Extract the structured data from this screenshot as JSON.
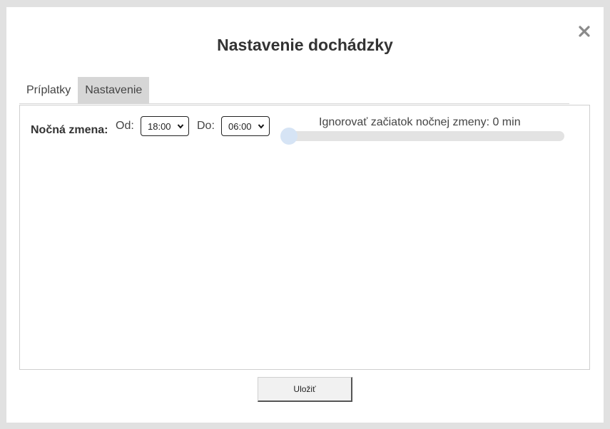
{
  "dialog": {
    "title": "Nastavenie dochádzky",
    "close_icon": "close-icon"
  },
  "tabs": [
    {
      "label": "Príplatky",
      "active": false
    },
    {
      "label": "Nastavenie",
      "active": true
    }
  ],
  "settings": {
    "night_shift_label": "Nočná zmena:",
    "from_label": "Od:",
    "from_value": "18:00",
    "to_label": "Do:",
    "to_value": "06:00",
    "ignore_start_caption": "Ignorovať začiatok nočnej zmeny: 0 min",
    "ignore_start_value_min": 0,
    "slider_fraction": 0
  },
  "footer": {
    "save_label": "Uložiť"
  },
  "colors": {
    "backdrop": "#e1e1e1",
    "active_tab": "#d6d6d6",
    "slider_thumb": "#d6e4f5",
    "slider_track": "#e3e3e3"
  }
}
